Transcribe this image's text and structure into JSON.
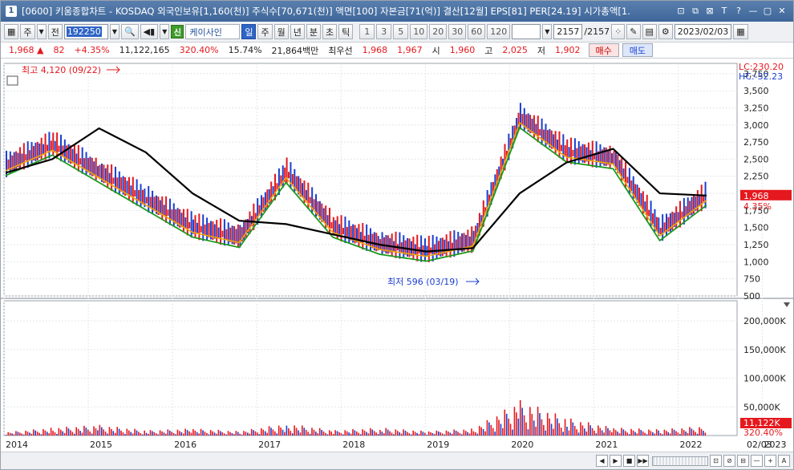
{
  "titlebar": {
    "number": "1",
    "text": "[0600] 키움종합차트 - KOSDAQ 외국인보유[1,160(천)] 주식수[70,671(천)] 액면[100] 자본금[71(억)] 결산[12월] EPS[81] PER[24.19] 시가총액[1.",
    "buttons": [
      "⊡",
      "⧉",
      "⊠",
      "T",
      "?",
      "—",
      "▢",
      "✕"
    ]
  },
  "toolbar": {
    "market": "주",
    "scope": "전",
    "code": "192250",
    "stock_badge": "신",
    "stock_name": "케이사인",
    "periods": [
      "일",
      "주",
      "월",
      "년",
      "분",
      "초",
      "틱"
    ],
    "selected_period": "일",
    "intervals": [
      "1",
      "3",
      "5",
      "10",
      "20",
      "30",
      "60",
      "120"
    ],
    "count": "2157",
    "total": "/2157",
    "date": "2023/02/03"
  },
  "quote": {
    "price": "1,968",
    "arrow": "▲",
    "change": "82",
    "pct": "+4.35%",
    "volume": "11,122,165",
    "vol_ratio": "320.40%",
    "turnover": "15.74%",
    "amount": "21,864백만",
    "best_label": "최우선",
    "ask": "1,968",
    "bid": "1,967",
    "open_label": "시",
    "open": "1,960",
    "high_label": "고",
    "high": "2,025",
    "low_label": "저",
    "low": "1,902",
    "buy": "매수",
    "sell": "매도"
  },
  "chart": {
    "high_annot": "최고 4,120 (09/22)",
    "low_annot": "최저 596 (03/19)",
    "lc_label": "LC:230.20",
    "hc_label": "HC:-52.23",
    "current_price": "1,968",
    "current_pct": "4.35%",
    "current_volume": "11,122K",
    "current_vol_pct": "320.40%",
    "x_date_label": "02/03",
    "colors": {
      "up": "#e5181e",
      "down": "#1a3fd0",
      "ma5": "#f0a30a",
      "ma20": "#1d9a1d",
      "ma60": "#228b22",
      "ma120": "#000000"
    }
  },
  "chart_data": {
    "type": "line",
    "x": [
      "2014",
      "2015",
      "2016",
      "2017",
      "2018",
      "2019",
      "2020",
      "2021",
      "2022",
      "2023"
    ],
    "price_axis": {
      "ticks": [
        500,
        750,
        1000,
        1250,
        1500,
        1750,
        2000,
        2250,
        2500,
        2750,
        3000,
        3250,
        3500,
        3750
      ],
      "ylim": [
        500,
        3900
      ]
    },
    "volume_axis": {
      "ticks": [
        "50,000K",
        "100,000K",
        "150,000K",
        "200,000K"
      ],
      "ylim": [
        0,
        235000
      ]
    },
    "series": [
      {
        "name": "close",
        "values": [
          2400,
          2700,
          2300,
          1900,
          1500,
          1350,
          2300,
          1500,
          1250,
          1150,
          1300,
          3100,
          2600,
          2500,
          1450,
          1968
        ]
      }
    ],
    "ma120_values": [
      2300,
      2500,
      2950,
      2600,
      2000,
      1600,
      1550,
      1400,
      1250,
      1150,
      1200,
      2000,
      2450,
      2650,
      2000,
      1968
    ],
    "volume_values": [
      4000,
      9000,
      12000,
      6000,
      8000,
      5000,
      14000,
      6000,
      9000,
      5000,
      8000,
      40000,
      20000,
      9000,
      7000,
      11122
    ]
  }
}
